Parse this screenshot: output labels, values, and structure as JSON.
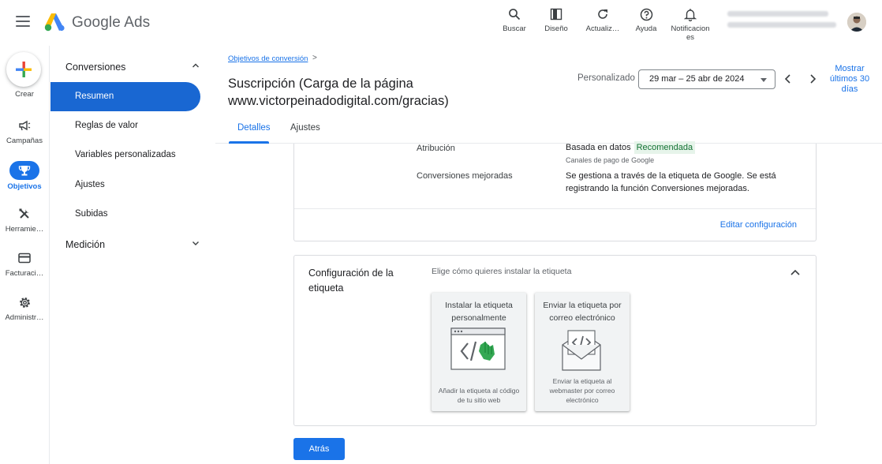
{
  "header": {
    "product_name": "Google Ads",
    "actions": [
      {
        "label": "Buscar",
        "icon": "search-icon"
      },
      {
        "label": "Diseño",
        "icon": "layout-icon"
      },
      {
        "label": "Actualiz…",
        "icon": "refresh-icon"
      },
      {
        "label": "Ayuda",
        "icon": "help-icon"
      },
      {
        "label": "Notificacion es",
        "icon": "bell-icon"
      }
    ]
  },
  "rail": {
    "create": "Crear",
    "items": [
      {
        "label": "Campañas",
        "icon": "megaphone-icon"
      },
      {
        "label": "Objetivos",
        "icon": "trophy-icon",
        "active": true
      },
      {
        "label": "Herramie…",
        "icon": "tools-icon"
      },
      {
        "label": "Facturaci…",
        "icon": "credit-card-icon"
      },
      {
        "label": "Administr…",
        "icon": "settings-icon"
      }
    ]
  },
  "subnav": {
    "section1": "Conversiones",
    "items": [
      "Resumen",
      "Reglas de valor",
      "Variables personalizadas",
      "Ajustes",
      "Subidas"
    ],
    "section2": "Medición"
  },
  "main": {
    "breadcrumb": "Objetivos de conversión",
    "breadcrumb_sep": ">",
    "title_line1": "Suscripción (Carga de la página",
    "title_line2": "www.victorpeinadodigital.com/gracias)",
    "date_label": "Personalizado",
    "date_range": "29 mar – 25 abr de 2024",
    "show_last_30": "Mostrar últimos 30 días",
    "tabs": [
      "Detalles",
      "Ajustes"
    ]
  },
  "settings_card": {
    "attribution_label": "Atribución",
    "attribution_value": "Basada en datos",
    "attribution_badge": "Recomendada",
    "attribution_sub": "Canales de pago de Google",
    "enhanced_label": "Conversiones mejoradas",
    "enhanced_value": "Se gestiona a través de la etiqueta de Google. Se está registrando la función Conversiones mejoradas.",
    "edit_link": "Editar configuración"
  },
  "tag_card": {
    "title": "Configuración de la etiqueta",
    "subtitle": "Elige cómo quieres instalar la etiqueta",
    "options": [
      {
        "title": "Instalar la etiqueta personalmente",
        "desc": "Añadir la etiqueta al código de tu sitio web"
      },
      {
        "title": "Enviar la etiqueta por correo electrónico",
        "desc": "Enviar la etiqueta al webmaster por correo electrónico"
      }
    ]
  },
  "footer": {
    "back_button": "Atrás"
  },
  "colors": {
    "accent": "#1a73e8",
    "nav_active": "#1967d2",
    "badge_bg": "#e6f4ea",
    "badge_text": "#137333"
  }
}
